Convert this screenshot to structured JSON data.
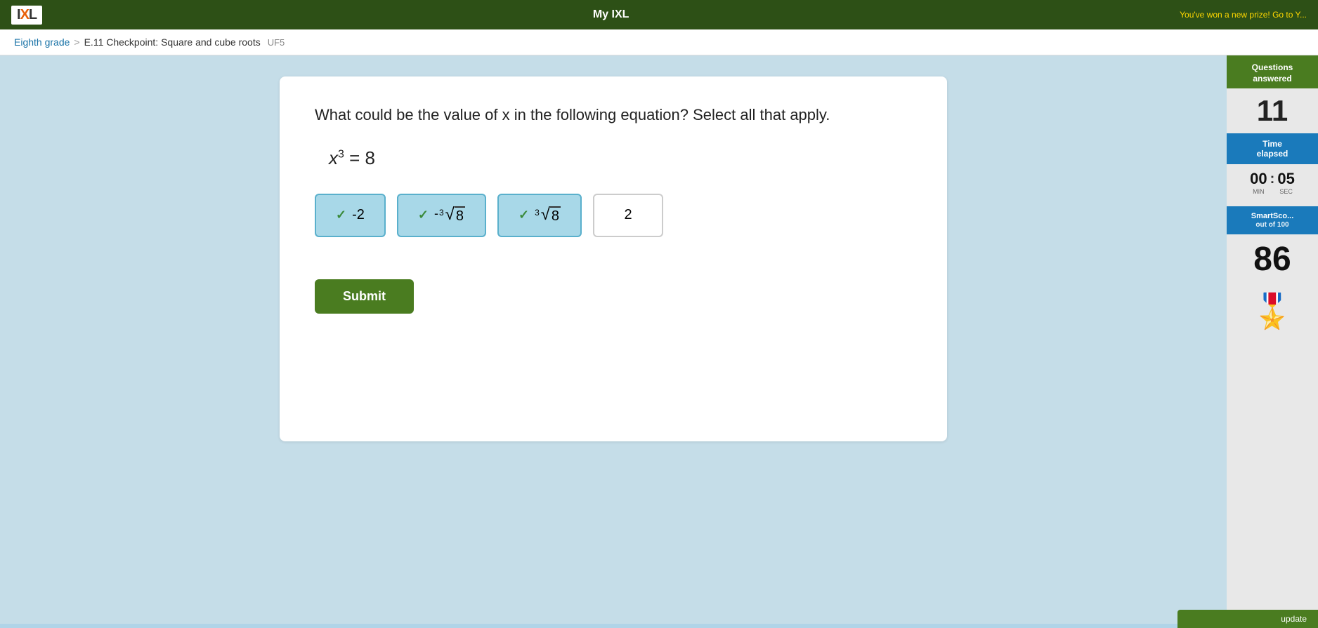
{
  "header": {
    "logo_text": "IXL",
    "nav_center": "My IXL",
    "prize_text": "You've won a new prize! Go to Y..."
  },
  "breadcrumb": {
    "grade": "Eighth grade",
    "separator": ">",
    "lesson": "E.11 Checkpoint: Square and cube roots",
    "code": "UF5"
  },
  "question": {
    "text": "What could be the value of x in the following equation? Select all that apply.",
    "equation": "x³ = 8",
    "choices": [
      {
        "id": "a",
        "label": "-2",
        "selected": true,
        "math_type": "plain"
      },
      {
        "id": "b",
        "label": "-³√8",
        "selected": true,
        "math_type": "neg-cube-root"
      },
      {
        "id": "c",
        "label": "³√8",
        "selected": true,
        "math_type": "cube-root"
      },
      {
        "id": "d",
        "label": "2",
        "selected": false,
        "math_type": "plain"
      }
    ],
    "submit_label": "Submit"
  },
  "sidebar": {
    "questions_label": "Questions\nanswered",
    "questions_count": "11",
    "time_label": "Time\nelapsed",
    "time_minutes": "00",
    "time_seconds": "05",
    "time_min_label": "MIN",
    "time_sec_label": "SEC",
    "smartscore_label": "SmartSco...",
    "smartscore_sub": "out of 100",
    "smartscore_value": "86"
  },
  "colors": {
    "dark_green": "#4a7c20",
    "blue": "#1a7abb",
    "selected_bg": "#a8d8e8",
    "selected_border": "#5ab0cc"
  }
}
